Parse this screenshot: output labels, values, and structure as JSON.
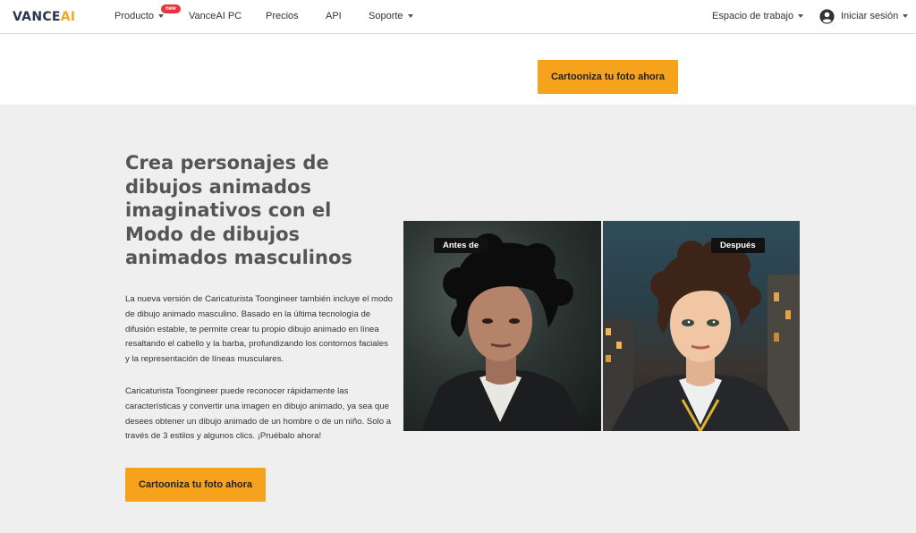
{
  "nav": {
    "logo_main": "VANCE",
    "logo_accent": "AI",
    "producto": "Producto",
    "new_badge": "new",
    "vanceai_pc": "VanceAI PC",
    "precios": "Precios",
    "api": "API",
    "soporte": "Soporte",
    "espacio": "Espacio de trabajo",
    "iniciar": "Iniciar sesión"
  },
  "top": {
    "cta": "Cartooniza tu foto ahora"
  },
  "section": {
    "heading": "Crea personajes de dibujos animados imaginativos con el Modo de dibujos animados masculinos",
    "paragraph1": "La nueva versión de Caricaturista Toongineer también incluye el modo de dibujo animado masculino. Basado en la última tecnología de difusión estable, te permite crear tu propio dibujo animado en línea resaltando el cabello y la barba, profundizando los contornos faciales y la representación de líneas musculares.",
    "paragraph2": "Caricaturista Toongineer puede reconocer rápidamente las características y convertir una imagen en dibujo animado, ya sea que desees obtener un dibujo animado de un hombre o de un niño. Solo a través de 3 estilos y algunos clics. ¡Pruébalo ahora!",
    "cta": "Cartooniza tu foto ahora",
    "before_label": "Antes de",
    "after_label": "Después"
  },
  "colors": {
    "accent": "#f7a21c",
    "badge": "#e5363c",
    "section_bg": "#efefef"
  }
}
